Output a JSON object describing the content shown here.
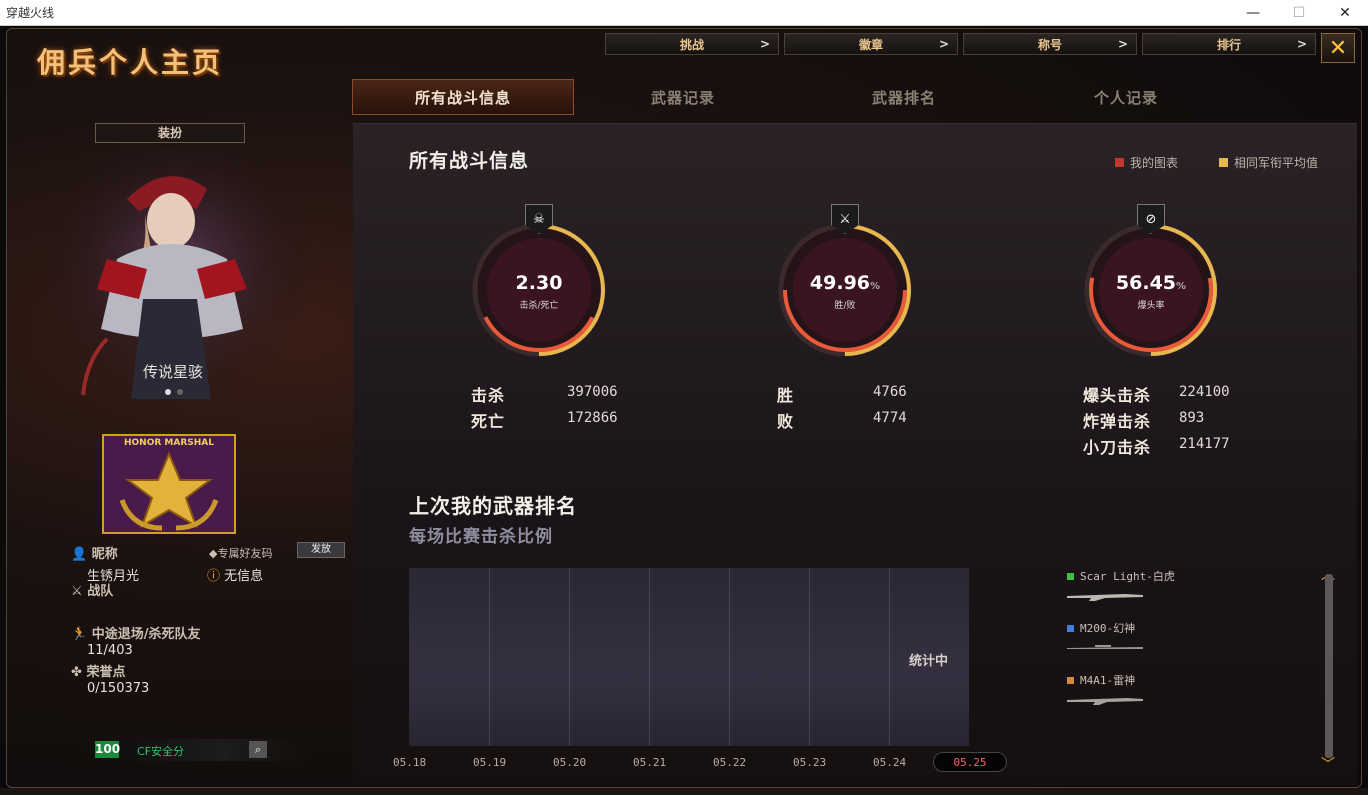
{
  "window": {
    "title": "穿越火线",
    "controls": [
      "—",
      "☐",
      "✕"
    ]
  },
  "header": {
    "title": "佣兵个人主页"
  },
  "topnav": [
    {
      "label": "挑战"
    },
    {
      "label": "徽章"
    },
    {
      "label": "称号"
    },
    {
      "label": "排行"
    }
  ],
  "close_label": "✕",
  "tabs": [
    {
      "label": "所有战斗信息",
      "active": true
    },
    {
      "label": "武器记录",
      "active": false
    },
    {
      "label": "武器排名",
      "active": false
    },
    {
      "label": "个人记录",
      "active": false
    }
  ],
  "sidebar": {
    "outfit_button": "装扮",
    "character_name": "传说星骇",
    "rank_badge_text": "HONOR MARSHAL",
    "nickname_label": "昵称",
    "nickname_value": "生锈月光",
    "friend_code_label": "专属好友码",
    "friend_code_button": "发放",
    "friend_code_value": "无信息",
    "team_label": "战队",
    "quit_label": "中途退场/杀死队友",
    "quit_value": "11/403",
    "honor_label": "荣誉点",
    "honor_value": "0/150373",
    "safety_score": "100",
    "safety_label": "CF安全分"
  },
  "battle": {
    "title": "所有战斗信息",
    "legend": [
      {
        "label": "我的图表",
        "color": "#c0392b"
      },
      {
        "label": "相同军衔平均值",
        "color": "#e6b84d"
      }
    ],
    "gauges": [
      {
        "value": "2.30",
        "unit": "",
        "label": "击杀/死亡",
        "fill": 0.35,
        "icon": "skull-icon"
      },
      {
        "value": "49.96",
        "unit": "%",
        "label": "胜/败",
        "fill": 0.4996,
        "icon": "crossed-swords-icon"
      },
      {
        "value": "56.45",
        "unit": "%",
        "label": "爆头率",
        "fill": 0.5645,
        "icon": "headshot-icon"
      }
    ],
    "stats": {
      "kills_label": "击杀",
      "kills": "397006",
      "deaths_label": "死亡",
      "deaths": "172866",
      "wins_label": "胜",
      "wins": "4766",
      "losses_label": "败",
      "losses": "4774",
      "headshot_label": "爆头击杀",
      "headshot": "224100",
      "grenade_label": "炸弹击杀",
      "grenade": "893",
      "knife_label": "小刀击杀",
      "knife": "214177"
    }
  },
  "weapon_rank": {
    "title": "上次我的武器排名",
    "subtitle": "每场比赛击杀比例",
    "status": "统计中",
    "dates": [
      "05.18",
      "05.19",
      "05.20",
      "05.21",
      "05.22",
      "05.23",
      "05.24",
      "05.25"
    ],
    "selected_date": "05.25",
    "weapons": [
      {
        "name": "Scar Light-白虎",
        "color": "#3fbf3f"
      },
      {
        "name": "M200-幻神",
        "color": "#3f7fd6"
      },
      {
        "name": "M4A1-雷神",
        "color": "#d08a3a"
      }
    ]
  }
}
